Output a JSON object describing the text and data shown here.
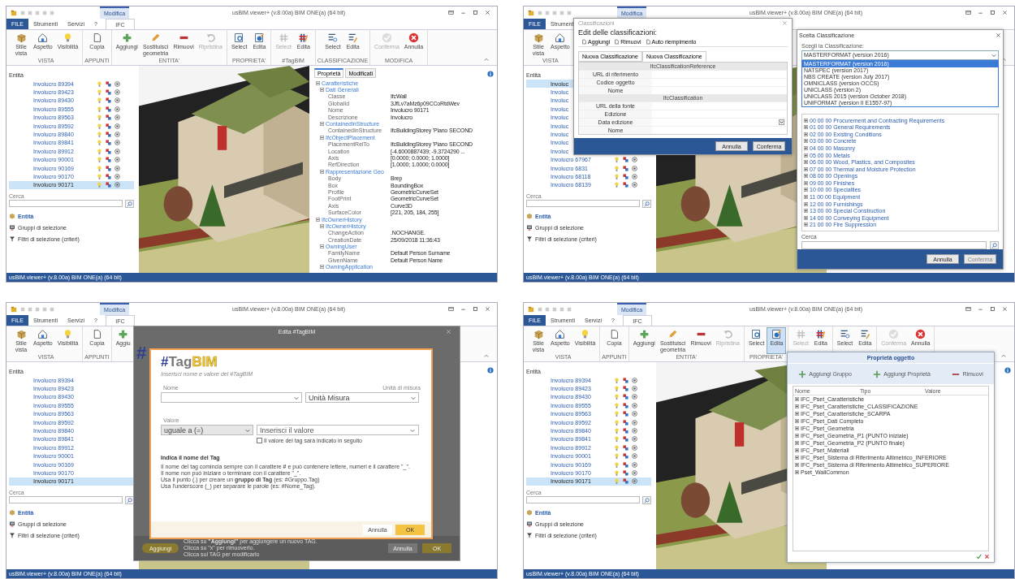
{
  "panels": [
    {
      "title": "usBIM.viewer+ (v.8.00a) BIM ONE(a) (64 bit)",
      "context_tab": "Modifica",
      "tabs": [
        {
          "label": "FILE",
          "selected": false
        },
        {
          "label": "Strumenti",
          "selected": false
        },
        {
          "label": "Servizi",
          "selected": false
        },
        {
          "label": "?",
          "selected": false
        },
        {
          "label": "IFC",
          "selected": true
        }
      ],
      "ribbon": [
        {
          "label": "VISTA",
          "buttons": [
            {
              "label": "Stile vista",
              "disabled": false,
              "selected": false
            },
            {
              "label": "Aspetto",
              "disabled": false,
              "selected": false
            },
            {
              "label": "Visibilità",
              "disabled": false,
              "selected": false
            }
          ]
        },
        {
          "label": "APPUNTI",
          "buttons": [
            {
              "label": "Copia",
              "disabled": false,
              "selected": false
            }
          ]
        },
        {
          "label": "ENTITA'",
          "buttons": [
            {
              "label": "Aggiungi",
              "disabled": false,
              "selected": false
            },
            {
              "label": "Sostituisci geometria",
              "disabled": false,
              "selected": false
            },
            {
              "label": "Rimuovi",
              "disabled": false,
              "selected": false
            },
            {
              "label": "Ripristina",
              "disabled": true,
              "selected": false
            }
          ]
        },
        {
          "label": "PROPRIETA'",
          "buttons": [
            {
              "label": "Select",
              "disabled": false,
              "selected": false
            },
            {
              "label": "Edita",
              "disabled": false,
              "selected": false
            }
          ]
        },
        {
          "label": "#TagBIM",
          "buttons": [
            {
              "label": "Select",
              "disabled": true,
              "selected": false
            },
            {
              "label": "Edita",
              "disabled": false,
              "selected": false
            }
          ]
        },
        {
          "label": "CLASSIFICAZIONE",
          "buttons": [
            {
              "label": "Select",
              "disabled": false,
              "selected": false
            },
            {
              "label": "Edita",
              "disabled": false,
              "selected": false
            }
          ]
        },
        {
          "label": "MODIFICA",
          "buttons": [
            {
              "label": "Conferma",
              "disabled": true,
              "selected": false
            },
            {
              "label": "Annulla",
              "disabled": false,
              "selected": false
            }
          ]
        }
      ],
      "tree_heading": "Entità",
      "tree": [
        {
          "label": "Involucro 89394",
          "selected": false,
          "icons": true
        },
        {
          "label": "Involucro 89423",
          "selected": false,
          "icons": true
        },
        {
          "label": "Involucro 89430",
          "selected": false,
          "icons": true
        },
        {
          "label": "Involucro 89555",
          "selected": false,
          "icons": true
        },
        {
          "label": "Involucro 89563",
          "selected": false,
          "icons": true
        },
        {
          "label": "Involucro 89592",
          "selected": false,
          "icons": true
        },
        {
          "label": "Involucro 89840",
          "selected": false,
          "icons": true
        },
        {
          "label": "Involucro 89841",
          "selected": false,
          "icons": true
        },
        {
          "label": "Involucro 89912",
          "selected": false,
          "icons": true
        },
        {
          "label": "Involucro 90001",
          "selected": false,
          "icons": true
        },
        {
          "label": "Involucro 90169",
          "selected": false,
          "icons": true
        },
        {
          "label": "Involucro 90170",
          "selected": false,
          "icons": true
        },
        {
          "label": "Involucro 90171",
          "selected": true,
          "icons": true
        }
      ],
      "search_label": "Cerca",
      "nav": [
        "Entità",
        "Gruppi di selezione",
        "Filtri di selezione (criteri)"
      ],
      "props": {
        "tabs": [
          {
            "label": "Proprietà",
            "selected": true
          },
          {
            "label": "Modificati",
            "selected": false
          }
        ],
        "rows": [
          {
            "label": "Caratteristiche",
            "expanded": true,
            "children": [
              {
                "label": "Dati Generali",
                "expanded": true,
                "children": [
                  {
                    "label": "Classe",
                    "value": "IfcWall"
                  },
                  {
                    "label": "GlobalId",
                    "value": "3JfLv7aMz6p09CCoRtdWev"
                  },
                  {
                    "label": "Nome",
                    "value": "Involucro 90171"
                  },
                  {
                    "label": "Descrizione",
                    "value": "Involucro"
                  }
                ]
              },
              {
                "label": "ContainedInStructure",
                "expanded": true,
                "children": [
                  {
                    "label": "ContainedInStructure",
                    "value": "IfcBuildingStorey 'Piano SECOND"
                  }
                ]
              },
              {
                "label": "IfcObjectPlacement",
                "expanded": true,
                "children": [
                  {
                    "label": "PlacementRelTo",
                    "value": "IfcBuildingStorey 'Piano SECOND"
                  },
                  {
                    "label": "Location",
                    "value": "[-4.6000887439; -9.3724290 ..."
                  },
                  {
                    "label": "Axis",
                    "value": "[0.0000; 0.0000; 1.0000]"
                  },
                  {
                    "label": "RefDirection",
                    "value": "[1.0000; 1.0000; 0.0000]"
                  }
                ]
              },
              {
                "label": "Rappresentazione Geo",
                "expanded": true,
                "children": [
                  {
                    "label": "Body",
                    "value": "Brep"
                  },
                  {
                    "label": "Box",
                    "value": "BoundingBox"
                  },
                  {
                    "label": "Profile",
                    "value": "GeometricCurveSet"
                  },
                  {
                    "label": "FootPrint",
                    "value": "GeometricCurveSet"
                  },
                  {
                    "label": "Axis",
                    "value": "Curve3D"
                  },
                  {
                    "label": "SurfaceColor",
                    "value": "[221, 205, 184, 255]"
                  }
                ]
              }
            ]
          },
          {
            "label": "IfcOwnerHistory",
            "expanded": true,
            "children": [
              {
                "label": "IfcOwnerHistory",
                "expanded": true,
                "children": [
                  {
                    "label": "ChangeAction",
                    "value": ".NOCHANGE."
                  },
                  {
                    "label": "CreationDate",
                    "value": "25/09/2018 11:36:43"
                  }
                ]
              },
              {
                "label": "OwningUser",
                "expanded": true,
                "children": [
                  {
                    "label": "FamilyName",
                    "value": "Default Person Surname"
                  },
                  {
                    "label": "GivenName",
                    "value": "Default Person Name"
                  }
                ]
              },
              {
                "label": "OwningApplication",
                "expanded": true
              }
            ]
          }
        ]
      },
      "status": "usBIM.viewer+ (v.8.00a) BIM ONE(a) (64 bit)"
    },
    {
      "title": "usBIM.viewer+ (v.8.00a) BIM ONE(a) (64 bit)",
      "context_tab": "Modifica",
      "tabs": [
        {
          "label": "FILE",
          "selected": false
        },
        {
          "label": "Strument",
          "selected": false
        }
      ],
      "ribbon": [
        {
          "label": "VISTA",
          "buttons": [
            {
              "label": "Stile vista",
              "disabled": false,
              "selected": false
            },
            {
              "label": "Aspetto",
              "disabled": false,
              "selected": false
            }
          ]
        }
      ],
      "tree_heading": "Entità",
      "tree": [
        {
          "label": "Involuc",
          "selected": true
        },
        {
          "label": "Involuc",
          "selected": false
        },
        {
          "label": "Involuc",
          "selected": false
        },
        {
          "label": "Involuc",
          "selected": false
        },
        {
          "label": "Involuc",
          "selected": false
        },
        {
          "label": "Involuc",
          "selected": false
        },
        {
          "label": "Involuc",
          "selected": false
        },
        {
          "label": "Involuc",
          "selected": false
        },
        {
          "label": "Involuc",
          "selected": false
        },
        {
          "label": "Involucro 67967",
          "selected": false,
          "icons": true
        },
        {
          "label": "Involucro 6831",
          "selected": false,
          "icons": true
        },
        {
          "label": "Involucro 68118",
          "selected": false,
          "icons": true
        },
        {
          "label": "Involucro 68139",
          "selected": false,
          "icons": true
        }
      ],
      "search_label": "Cerca",
      "nav": [
        "Entità",
        "Gruppi di selezione",
        "Filtri di selezione (criteri)"
      ],
      "status": "usBIM.viewer+ (v.8.00a) BIM ONE(a) (64 bit)",
      "dialogs": [
        {
          "kind": "classification_edit",
          "title": "Classificazioni",
          "heading": "Edit delle classificazioni:",
          "actions": [
            "Aggiungi",
            "Rimuovi",
            "Auto riempimento"
          ],
          "tabs": [
            {
              "label": "Nuova Classificazione",
              "selected": false
            },
            {
              "label": "Nuova Classificazione",
              "selected": true
            }
          ],
          "sections": [
            {
              "title": "IfcClassificationReference",
              "fields": [
                {
                  "label": "URL di riferimento",
                  "kind": "text"
                },
                {
                  "label": "Codice oggetto",
                  "kind": "text"
                },
                {
                  "label": "Nome",
                  "kind": "text"
                }
              ]
            },
            {
              "title": "IfcClassification",
              "fields": [
                {
                  "label": "URL della fonte",
                  "kind": "text"
                },
                {
                  "label": "Edizione",
                  "kind": "text"
                },
                {
                  "label": "Data edizione",
                  "kind": "date"
                },
                {
                  "label": "Nome",
                  "kind": "text"
                }
              ]
            }
          ],
          "buttons": [
            "Annulla",
            "Conferma"
          ]
        },
        {
          "kind": "classification_choice",
          "title": "Scelta Classificazione",
          "label": "Scegli la Classificazione:",
          "value": "MASTERFORMAT  (version 2016)",
          "options": [
            {
              "label": "MASTERFORMAT  (version 2016)",
              "selected": true
            },
            {
              "label": "NATSPEC  (version 2017)",
              "selected": false
            },
            {
              "label": "NBS CREATE  (version July 2017)",
              "selected": false
            },
            {
              "label": "OMNICLASS  (version OCCS)",
              "selected": false
            },
            {
              "label": "UNICLASS  (version 2)",
              "selected": false
            },
            {
              "label": "UNICLASS  2015 (version October 2018)",
              "selected": false
            },
            {
              "label": "UNIFORMAT  (version II E1557-97)",
              "selected": false
            }
          ],
          "items": [
            "00 00 00 Procurement and Contracting Requirements",
            "01 00 00 General Requirements",
            "02 00 00 Existing Conditions",
            "03 00 00 Concrete",
            "04 00 00 Masonry",
            "05 00 00 Metals",
            "06 00 00 Wood, Plastics, and Composites",
            "07 00 00 Thermal and Moisture Protection",
            "08 00 00 Openings",
            "09 00 00 Finishes",
            "10 00 00 Specialties",
            "11 00 00 Equipment",
            "12 00 00 Furnishings",
            "13 00 00 Special Construction",
            "14 00 00 Conveying Equipment",
            "21 00 00 Fire Suppression"
          ],
          "search_label": "Cerca",
          "buttons": [
            {
              "label": "Annulla",
              "disabled": false
            },
            {
              "label": "Conferma",
              "disabled": true
            }
          ]
        }
      ]
    },
    {
      "title": "usBIM.viewer+ (v.8.00a) BIM ONE(a) (64 bit)",
      "context_tab": "Modifica",
      "tabs": [
        {
          "label": "FILE",
          "selected": false
        },
        {
          "label": "Strumenti",
          "selected": false
        },
        {
          "label": "Servizi",
          "selected": false
        },
        {
          "label": "?",
          "selected": false
        },
        {
          "label": "IFC",
          "selected": true
        }
      ],
      "ribbon": [
        {
          "label": "VISTA",
          "buttons": [
            {
              "label": "Stile vista",
              "disabled": false,
              "selected": false
            },
            {
              "label": "Aspetto",
              "disabled": false,
              "selected": false
            },
            {
              "label": "Visibilità",
              "disabled": false,
              "selected": false
            }
          ]
        },
        {
          "label": "APPUNTI",
          "buttons": [
            {
              "label": "Copia",
              "disabled": false,
              "selected": false
            }
          ]
        },
        {
          "buttons": [
            {
              "label": "Aggiu",
              "disabled": false,
              "selected": false
            }
          ]
        }
      ],
      "tree_heading": "Entità",
      "tree": [
        {
          "label": "Involucro 89394",
          "selected": false
        },
        {
          "label": "Involucro 89423",
          "selected": false
        },
        {
          "label": "Involucro 89430",
          "selected": false
        },
        {
          "label": "Involucro 89555",
          "selected": false
        },
        {
          "label": "Involucro 89563",
          "selected": false
        },
        {
          "label": "Involucro 89592",
          "selected": false
        },
        {
          "label": "Involucro 89840",
          "selected": false
        },
        {
          "label": "Involucro 89841",
          "selected": false
        },
        {
          "label": "Involucro 89912",
          "selected": false
        },
        {
          "label": "Involucro 90001",
          "selected": false
        },
        {
          "label": "Involucro 90169",
          "selected": false
        },
        {
          "label": "Involucro 90170",
          "selected": false
        },
        {
          "label": "Involucro 90171",
          "selected": true
        }
      ],
      "search_label": "Cerca",
      "nav": [
        "Entità",
        "Gruppi di selezione",
        "Filtri di selezione (criteri)"
      ],
      "status": "usBIM.viewer+ (v.8.00a) BIM ONE(a) (64 bit)",
      "dialogs": [
        {
          "kind": "tagbim_back",
          "title": "Edita #TagBIM",
          "mark": "#",
          "add_button": "Aggiungi",
          "hints": [
            "Clicca su **\"Aggiungi\"** per aggiungere un nuovo TAG.",
            "Clicca su \"x\" per rimuoverlo.",
            "Clicca sul TAG per modificarlo"
          ],
          "buttons": [
            "Annulla",
            "OK"
          ]
        },
        {
          "kind": "tagbim",
          "logo": [
            "#",
            "Tag",
            "BIM"
          ],
          "subtitle": "Inserisci nome e valore del #TagBIM",
          "name_label": "Nome",
          "unit_label": "Unità di misura",
          "unit_value": "Unità Misura",
          "value_label": "Valore",
          "operator": "uguale a (=)",
          "value_placeholder": "Inserisci il valore",
          "later": {
            "label": "Il valore del tag sarà indicato in seguito",
            "checked": false
          },
          "help_title": "Indica il nome del Tag",
          "help": [
            "Il nome del tag comincia sempre con il carattere **#** e può contenere lettere, numeri e il carattere \"_\".",
            "Il nome non può iniziare o terminare con il carattere \"_\".",
            "Usa il punto (.) per creare un **gruppo di Tag** (es: #Gruppo.Tag)",
            "Usa l'underscore (_) per separare le parole (es: #Nome_Tag)."
          ],
          "buttons": [
            "Annulla",
            "OK"
          ]
        }
      ]
    },
    {
      "title": "usBIM.viewer+ (v.8.00a) BIM ONE(a) (64 bit)",
      "context_tab": "Modifica",
      "tabs": [
        {
          "label": "FILE",
          "selected": false
        },
        {
          "label": "Strumenti",
          "selected": false
        },
        {
          "label": "Servizi",
          "selected": false
        },
        {
          "label": "?",
          "selected": false
        },
        {
          "label": "IFC",
          "selected": true
        }
      ],
      "ribbon": [
        {
          "label": "VISTA",
          "buttons": [
            {
              "label": "Stile vista",
              "disabled": false,
              "selected": false
            },
            {
              "label": "Aspetto",
              "disabled": false,
              "selected": false
            },
            {
              "label": "Visibilità",
              "disabled": false,
              "selected": false
            }
          ]
        },
        {
          "label": "APPUNTI",
          "buttons": [
            {
              "label": "Copia",
              "disabled": false,
              "selected": false
            }
          ]
        },
        {
          "label": "ENTITA'",
          "buttons": [
            {
              "label": "Aggiungi",
              "disabled": false,
              "selected": false
            },
            {
              "label": "Sostituisci geometria",
              "disabled": false,
              "selected": false
            },
            {
              "label": "Rimuovi",
              "disabled": false,
              "selected": false
            },
            {
              "label": "Ripristina",
              "disabled": true,
              "selected": false
            }
          ]
        },
        {
          "label": "PROPRIETA'",
          "buttons": [
            {
              "label": "Select",
              "disabled": false,
              "selected": false
            },
            {
              "label": "Edita",
              "disabled": false,
              "selected": true
            }
          ]
        },
        {
          "buttons": [
            {
              "label": "Select",
              "disabled": true,
              "selected": false
            },
            {
              "label": "Edita",
              "disabled": false,
              "selected": false
            }
          ]
        },
        {
          "buttons": [
            {
              "label": "Select",
              "disabled": false,
              "selected": false
            },
            {
              "label": "Edita",
              "disabled": false,
              "selected": false
            }
          ]
        },
        {
          "buttons": [
            {
              "label": "Conferma",
              "disabled": true,
              "selected": false
            },
            {
              "label": "Annulla",
              "disabled": false,
              "selected": false
            }
          ]
        }
      ],
      "tree_heading": "Entità",
      "tree": [
        {
          "label": "Involucro 89394",
          "selected": false,
          "icons": true
        },
        {
          "label": "Involucro 89423",
          "selected": false,
          "icons": true
        },
        {
          "label": "Involucro 89430",
          "selected": false,
          "icons": true
        },
        {
          "label": "Involucro 89555",
          "selected": false,
          "icons": true
        },
        {
          "label": "Involucro 89563",
          "selected": false,
          "icons": true
        },
        {
          "label": "Involucro 89592",
          "selected": false,
          "icons": true
        },
        {
          "label": "Involucro 89840",
          "selected": false,
          "icons": true
        },
        {
          "label": "Involucro 89841",
          "selected": false,
          "icons": true
        },
        {
          "label": "Involucro 89912",
          "selected": false,
          "icons": true
        },
        {
          "label": "Involucro 90001",
          "selected": false,
          "icons": true
        },
        {
          "label": "Involucro 90169",
          "selected": false,
          "icons": true
        },
        {
          "label": "Involucro 90170",
          "selected": false,
          "icons": true
        },
        {
          "label": "Involucro 90171",
          "selected": true,
          "icons": true
        }
      ],
      "search_label": "Cerca",
      "nav": [
        "Entità",
        "Gruppi di selezione",
        "Filtri di selezione (criteri)"
      ],
      "status": "usBIM.viewer+ (v.8.00a) BIM ONE(a) (64 bit)",
      "dialogs": [
        {
          "kind": "object_properties",
          "title": "Proprietà oggetto",
          "actions": [
            {
              "label": "Aggiungi Gruppo",
              "kind": "add"
            },
            {
              "label": "Aggiungi Proprietà",
              "kind": "add"
            },
            {
              "label": "Rimuovi",
              "kind": "remove"
            }
          ],
          "columns": [
            "Nome",
            "Tipo",
            "Valore"
          ],
          "rows": [
            "IFC_Pset_Caratteristiche",
            "IFC_Pset_Caratteristiche_CLASSIFICAZIONE",
            "IFC_Pset_Caratteristiche_SCARPA",
            "IFC_Pset_Dati Completo",
            "IFC_Pset_Geometria",
            "IFC_Pset_Geometria_P1 (PUNTO iniziale)",
            "IFC_Pset_Geometria_P2 (PUNTO finale)",
            "IFC_Pset_Materiali",
            "IFC_Pset_Sistema di Riferimento Altimetrico_INFERIORE",
            "IFC_Pset_Sistema di Riferimento Altimetrico_SUPERIORE",
            "Pset_WallCommon"
          ]
        }
      ]
    }
  ]
}
